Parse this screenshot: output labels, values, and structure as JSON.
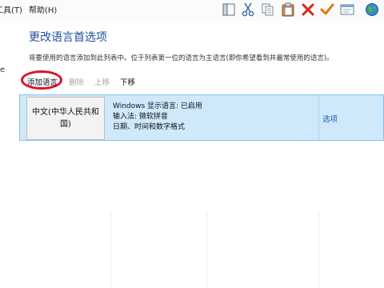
{
  "menu": {
    "tools_label": "工具(T)",
    "help_label": "帮助(H)"
  },
  "toolbar": {
    "icons": [
      "layout-icon",
      "cut-icon",
      "copy-icon",
      "paste-icon",
      "delete-icon",
      "check-icon",
      "properties-icon",
      "globe-icon"
    ]
  },
  "sidebar_fragment": "e",
  "page": {
    "title": "更改语言首选项",
    "description": "将要使用的语言添加到此列表中。位于列表第一位的语言为主语言(即你希望看到并最常使用的语言)。"
  },
  "actions": {
    "add": "添加语言",
    "remove": "删除",
    "move_up": "上移",
    "move_down": "下移"
  },
  "languages": [
    {
      "name": "中文(中华人民共和国)",
      "display_language": "Windows 显示语言: 已启用",
      "input_method": "输入法: 微软拼音",
      "formats": "日期、时间和数字格式",
      "options_label": "选项"
    }
  ],
  "colors": {
    "title": "#1e4f9c",
    "selected_row_bg": "#cfe9fb",
    "selected_row_border": "#85c4ee",
    "highlight_ring": "#e0102a",
    "link": "#1a5fb4"
  }
}
